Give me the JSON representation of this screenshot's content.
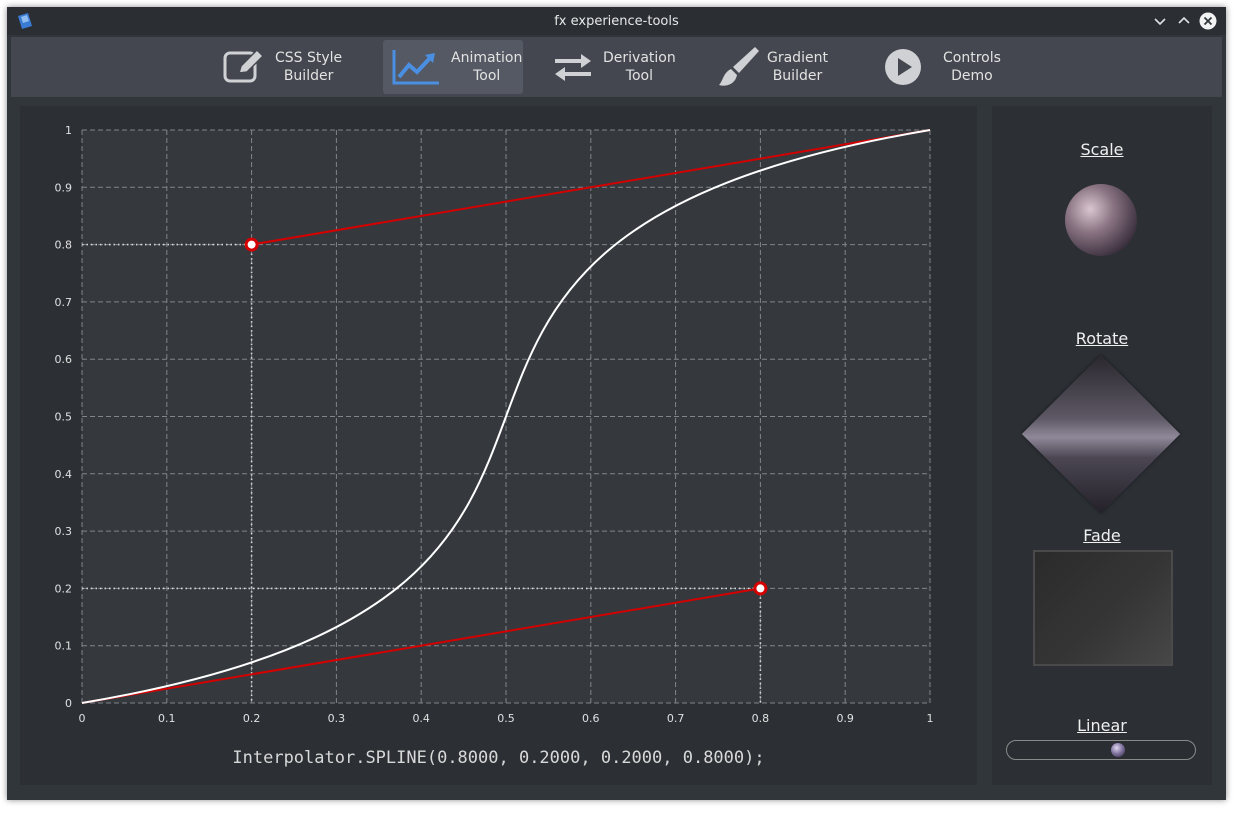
{
  "window": {
    "title": "fx experience-tools"
  },
  "toolbar": {
    "items": [
      {
        "line1": "CSS Style",
        "line2": "Builder",
        "icon": "edit-icon",
        "active": false
      },
      {
        "line1": "Animation",
        "line2": "Tool",
        "icon": "line-chart-icon",
        "active": true
      },
      {
        "line1": "Derivation",
        "line2": "Tool",
        "icon": "swap-arrows-icon",
        "active": false
      },
      {
        "line1": "Gradient",
        "line2": "Builder",
        "icon": "paint-brush-icon",
        "active": false
      },
      {
        "line1": "Controls",
        "line2": "Demo",
        "icon": "play-circle-icon",
        "active": false
      }
    ],
    "accent": "#4a8fe2"
  },
  "chart_data": {
    "type": "line",
    "title": "",
    "xlabel": "",
    "ylabel": "",
    "xlim": [
      0,
      1
    ],
    "ylim": [
      0,
      1
    ],
    "x_ticks": [
      "0",
      "0.1",
      "0.2",
      "0.3",
      "0.4",
      "0.5",
      "0.6",
      "0.7",
      "0.8",
      "0.9",
      "1"
    ],
    "y_ticks": [
      "0",
      "0.1",
      "0.2",
      "0.3",
      "0.4",
      "0.5",
      "0.6",
      "0.7",
      "0.8",
      "0.9",
      "1"
    ],
    "grid": true,
    "curve": {
      "kind": "cubic-bezier",
      "p0": [
        0,
        0
      ],
      "p1": [
        0.8,
        0.2
      ],
      "p2": [
        0.2,
        0.8
      ],
      "p3": [
        1,
        1
      ],
      "color": "#ffffff"
    },
    "control_points": [
      {
        "x": 0.2,
        "y": 0.8
      },
      {
        "x": 0.8,
        "y": 0.2
      }
    ],
    "handle_lines": [
      {
        "from": [
          0.2,
          0.8
        ],
        "to": [
          1,
          1
        ]
      },
      {
        "from": [
          0,
          0
        ],
        "to": [
          0.8,
          0.2
        ]
      }
    ],
    "handle_color": "#d40000"
  },
  "formula": "Interpolator.SPLINE(0.8000, 0.2000, 0.2000, 0.8000);",
  "preview": {
    "scale_label": "Scale",
    "rotate_label": "Rotate",
    "fade_label": "Fade",
    "linear_label": "Linear",
    "slider_value": 0.6
  }
}
